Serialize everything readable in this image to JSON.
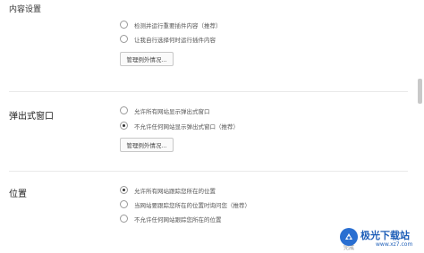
{
  "header": {
    "title": "内容设置"
  },
  "plugins": {
    "options": [
      {
        "label": "检测并运行重要插件内容（推荐）",
        "checked": false
      },
      {
        "label": "让我自行选择何时运行插件内容",
        "checked": false
      }
    ],
    "manage_label": "管理例外情况..."
  },
  "popups": {
    "title": "弹出式窗口",
    "options": [
      {
        "label": "允许所有网站显示弹出式窗口",
        "checked": false
      },
      {
        "label": "不允许任何网站显示弹出式窗口（推荐）",
        "checked": true
      }
    ],
    "manage_label": "管理例外情况..."
  },
  "location": {
    "title": "位置",
    "options": [
      {
        "label": "允许所有网站跟踪您所在的位置",
        "checked": true
      },
      {
        "label": "当网站要跟踪您所在的位置时询问您（推荐）",
        "checked": false
      },
      {
        "label": "不允许任何网站跟踪您所在的位置",
        "checked": false
      }
    ]
  },
  "footer": {
    "text": "完成"
  },
  "watermark": {
    "name": "极光下载站",
    "site": "www.xz7.com"
  },
  "colors": {
    "accent": "#1f5fb8",
    "divider": "#e9e9e9"
  }
}
